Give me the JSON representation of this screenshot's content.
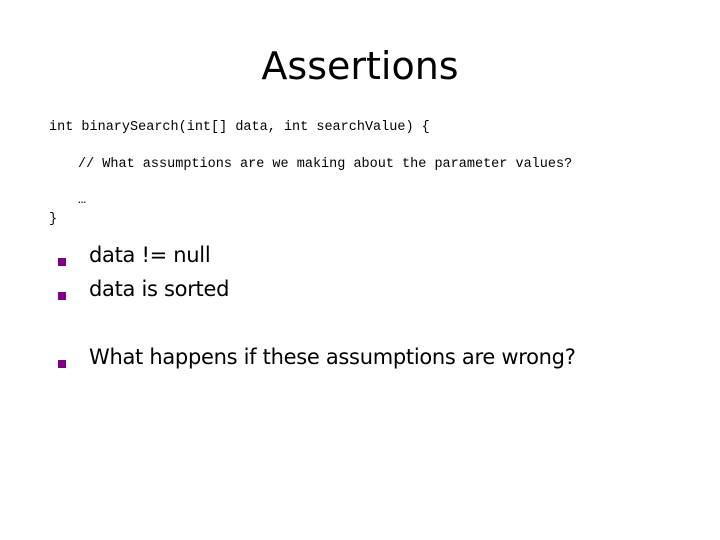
{
  "slide": {
    "title": "Assertions",
    "code": {
      "signature": "int binarySearch(int[] data, int searchValue) {",
      "comment": "// What assumptions are we making about the parameter values?",
      "ellipsis": "…",
      "closing": "}"
    },
    "bullets": [
      {
        "text": "data != null"
      },
      {
        "text": "data is sorted"
      },
      {
        "text": "What happens if these assumptions are wrong?"
      }
    ],
    "bullet_color": "#800080"
  }
}
